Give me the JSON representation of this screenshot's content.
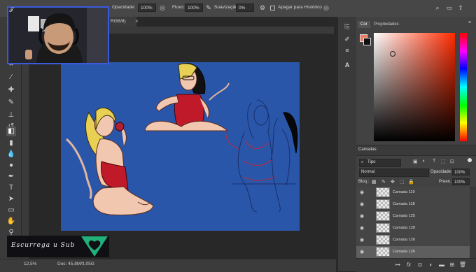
{
  "options_bar": {
    "opacity_label": "Opacidade:",
    "opacity_value": "100%",
    "flow_label": "Fluxo:",
    "flow_value": "100%",
    "smoothing_label": "Suavização:",
    "smoothing_value": "0%",
    "erase_history_label": "Apagar para Histórico"
  },
  "document": {
    "tab_title": "RGB/8)",
    "tab_close": "×",
    "zoom": "12,5%",
    "doc_info": "Doc: 45,8M/1,05G",
    "canvas_color": "#2a56a9"
  },
  "right_panel": {
    "tabs": [
      "Cor",
      "Propriedades"
    ],
    "fg_color": "#f07b62",
    "bg_color": "#111111"
  },
  "layers": {
    "tab_label": "Camadas",
    "kind_filter": "Tipo",
    "blend_mode": "Normal",
    "opacity_label": "Opacidade:",
    "opacity_value": "100%",
    "lock_label": "Bloq.:",
    "fill_label": "Preen.:",
    "fill_value": "100%",
    "rows": [
      {
        "name": "Camada 119",
        "selected": false
      },
      {
        "name": "Camada 118",
        "selected": false
      },
      {
        "name": "Camada 125",
        "selected": false
      },
      {
        "name": "Camada 128",
        "selected": false
      },
      {
        "name": "Camada 126",
        "selected": false
      },
      {
        "name": "Camada 126",
        "selected": true
      }
    ]
  },
  "overlay": {
    "brand_text": "Escurrega u Sub"
  },
  "icons": {
    "toolbar": [
      "move-icon",
      "marquee-icon",
      "lasso-icon",
      "magic-wand-icon",
      "crop-icon",
      "eyedropper-icon",
      "healing-icon",
      "brush-icon",
      "stamp-icon",
      "history-brush-icon",
      "eraser-icon",
      "gradient-icon",
      "blur-icon",
      "dodge-icon",
      "pen-icon",
      "type-icon",
      "path-select-icon",
      "shape-icon",
      "hand-icon",
      "zoom-icon"
    ]
  }
}
